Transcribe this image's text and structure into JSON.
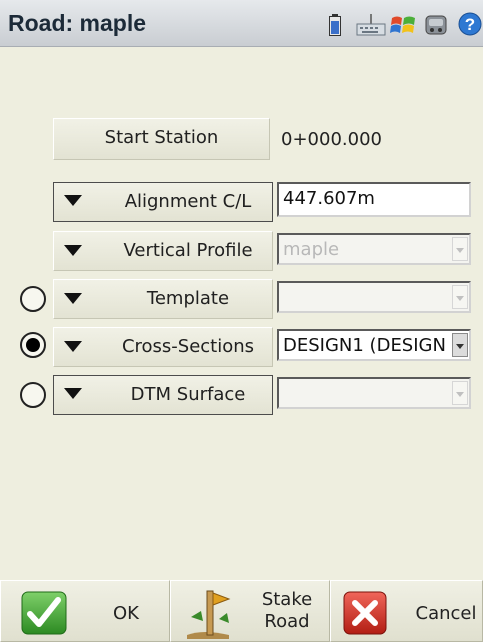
{
  "title": "Road: maple",
  "title_icons": [
    "battery-icon",
    "keyboard-icon",
    "windows-flag-icon",
    "controller-icon",
    "help-icon"
  ],
  "start_station": {
    "label": "Start Station",
    "value": "0+000.000"
  },
  "alignment": {
    "label": "Alignment C/L",
    "value": "447.607m"
  },
  "vertical_profile": {
    "label": "Vertical Profile",
    "value": "maple"
  },
  "template": {
    "label": "Template",
    "value": "",
    "selected": false
  },
  "cross_sections": {
    "label": "Cross-Sections",
    "value": "DESIGN1 (DESIGN",
    "selected": true
  },
  "dtm_surface": {
    "label": "DTM Surface",
    "value": "",
    "selected": false
  },
  "bottom": {
    "ok": "OK",
    "stake_line1": "Stake",
    "stake_line2": "Road",
    "cancel": "Cancel"
  },
  "colors": {
    "ok_green": "#3a9a2c",
    "cancel_red": "#c8281e",
    "title_text": "#1c2a38",
    "background": "#eeeedf"
  }
}
